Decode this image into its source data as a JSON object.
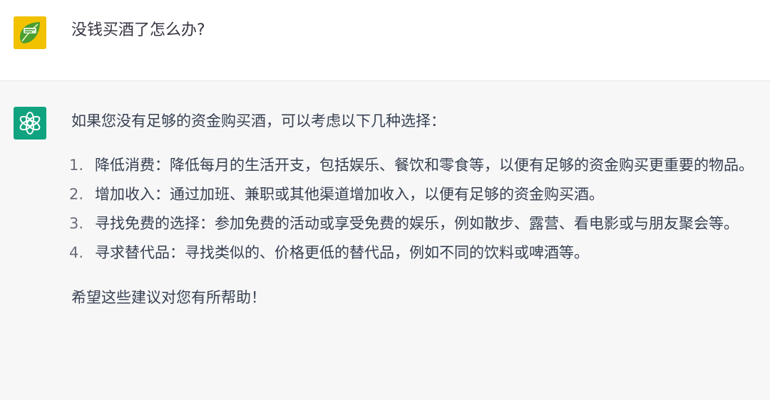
{
  "user_message": {
    "avatar_icon": "lime-leaf-logo-icon",
    "text": "没钱买酒了怎么办?"
  },
  "assistant_message": {
    "avatar_icon": "openai-logo-icon",
    "accent_color": "#10a37f",
    "intro": "如果您没有足够的资金购买酒，可以考虑以下几种选择：",
    "items": [
      {
        "number": "1.",
        "text": "降低消费：降低每月的生活开支，包括娱乐、餐饮和零食等，以便有足够的资金购买更重要的物品。"
      },
      {
        "number": "2.",
        "text": "增加收入：通过加班、兼职或其他渠道增加收入，以便有足够的资金购买酒。"
      },
      {
        "number": "3.",
        "text": "寻找免费的选择：参加免费的活动或享受免费的娱乐，例如散步、露营、看电影或与朋友聚会等。"
      },
      {
        "number": "4.",
        "text": "寻求替代品：寻找类似的、价格更低的替代品，例如不同的饮料或啤酒等。"
      }
    ],
    "outro": "希望这些建议对您有所帮助！"
  }
}
